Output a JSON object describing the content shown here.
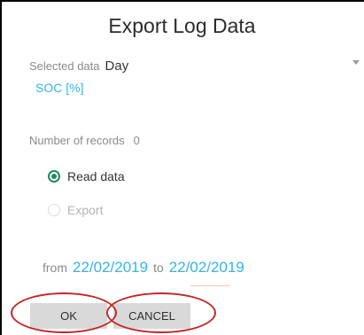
{
  "dialog": {
    "title": "Export Log Data",
    "selected_data_label": "Selected data",
    "selected_data_value": "Day",
    "series_value": "SOC [%]",
    "records_label": "Number of records",
    "records_value": "0",
    "options": [
      {
        "label": "Read data",
        "selected": true
      },
      {
        "label": "Export",
        "selected": false
      }
    ],
    "from_label": "from",
    "from_date": "22/02/2019",
    "to_label": "to",
    "to_date": "22/02/2019",
    "ok_label": "OK",
    "cancel_label": "CANCEL"
  },
  "colors": {
    "accent": "#33b5e5",
    "radio_selected": "#1f8a5f",
    "annotation": "#c0282a"
  },
  "icons": {
    "dropdown": "chevron-down-icon"
  }
}
